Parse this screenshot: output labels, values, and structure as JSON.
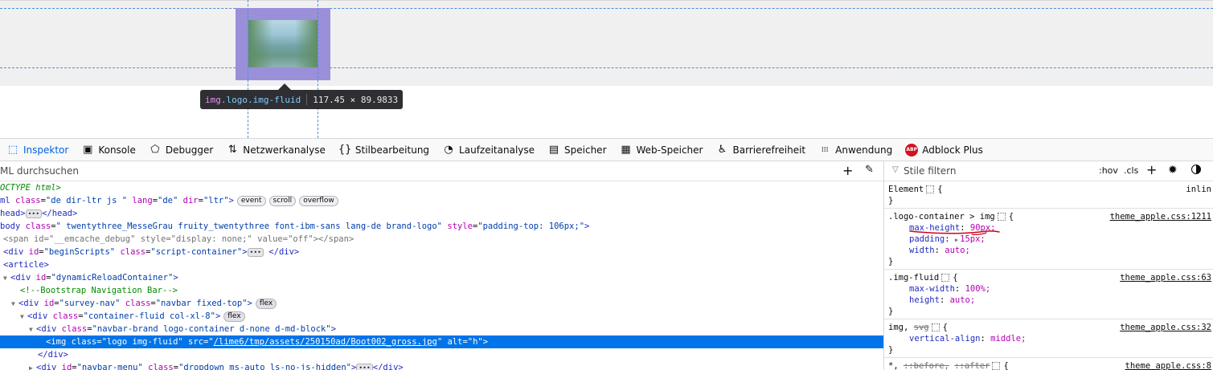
{
  "tooltip": {
    "tag": "img",
    "classes": ".logo.img-fluid",
    "dimensions": "117.45 × 89.9833"
  },
  "tabs": [
    {
      "label": "Inspektor",
      "icon": "inspector-icon",
      "glyph": "⬚"
    },
    {
      "label": "Konsole",
      "icon": "console-icon",
      "glyph": "▣"
    },
    {
      "label": "Debugger",
      "icon": "debugger-icon",
      "glyph": "⬠"
    },
    {
      "label": "Netzwerkanalyse",
      "icon": "network-icon",
      "glyph": "⇅"
    },
    {
      "label": "Stilbearbeitung",
      "icon": "style-editor-icon",
      "glyph": "{}"
    },
    {
      "label": "Laufzeitanalyse",
      "icon": "performance-icon",
      "glyph": "◔"
    },
    {
      "label": "Speicher",
      "icon": "memory-icon",
      "glyph": "▤"
    },
    {
      "label": "Web-Speicher",
      "icon": "storage-icon",
      "glyph": "▦"
    },
    {
      "label": "Barrierefreiheit",
      "icon": "accessibility-icon",
      "glyph": "♿"
    },
    {
      "label": "Anwendung",
      "icon": "application-icon",
      "glyph": "⁞⁞⁞"
    },
    {
      "label": "Adblock Plus",
      "icon": "adblock-plus-icon",
      "glyph": "ABP"
    }
  ],
  "markup": {
    "search_label": "ML durchsuchen",
    "lines": {
      "doctype": "OCTYPE html>",
      "html_tag": "ml",
      "html_class_attr": "class",
      "html_class_val": "\"de dir-ltr js \"",
      "html_lang_attr": "lang",
      "html_lang_val": "\"de\"",
      "html_dir_attr": "dir",
      "html_dir_val": "\"ltr\"",
      "badge_event": "event",
      "badge_scroll": "scroll",
      "badge_overflow": "overflow",
      "head_open": "head>",
      "head_close": "</head>",
      "body_tag": "body",
      "body_class_attr": "class",
      "body_class_val": "\"  twentythree_MesseGrau fruity_twentythree font-ibm-sans lang-de brand-logo\"",
      "body_style_attr": "style",
      "body_style_val": "\"padding-top: 106px;\"",
      "span_tag": "<span",
      "span_id_attr": "id",
      "span_id_val": "\"__emcache_debug\"",
      "span_style_attr": "style",
      "span_style_val": "\"display: none;\"",
      "span_value_attr": "value",
      "span_value_val": "\"off\"",
      "span_close": "></span>",
      "div_begin_tag": "<div",
      "div_begin_id_attr": "id",
      "div_begin_id_val": "\"beginScripts\"",
      "div_begin_class_attr": "class",
      "div_begin_class_val": "\"script-container\"",
      "div_close_tag": "</div>",
      "article": "<article>",
      "div_dyn_tag": "<div",
      "div_dyn_id_attr": "id",
      "div_dyn_id_val": "\"dynamicReloadContainer\"",
      "comment": "<!--Bootstrap Navigation Bar-->",
      "div_survey_tag": "<div",
      "div_survey_id_attr": "id",
      "div_survey_id_val": "\"survey-nav\"",
      "div_survey_class_attr": "class",
      "div_survey_class_val": "\"navbar fixed-top\"",
      "badge_flex": "flex",
      "div_container_tag": "<div",
      "div_container_class_attr": "class",
      "div_container_class_val": "\"container-fluid col-xl-8\"",
      "div_brand_tag": "<div",
      "div_brand_class_attr": "class",
      "div_brand_class_val": "\"navbar-brand logo-container d-none d-md-block\"",
      "img_tag": "<img",
      "img_class_attr": "class",
      "img_class_val": "\"logo img-fluid\"",
      "img_src_attr": "src",
      "img_src_val": "/lime6/tmp/assets/250150ad/Boot002_gross.jpg",
      "img_alt_attr": "alt",
      "img_alt_val": "\"h\"",
      "div_end": "</div>",
      "div_menu_tag": "<div",
      "div_menu_id_attr": "id",
      "div_menu_id_val": "\"navbar-menu\"",
      "div_menu_class_attr": "class",
      "div_menu_class_val": "\"dropdown ms-auto ls-no-js-hidden\"",
      "ellipsis": "•••"
    }
  },
  "rules": {
    "filter_label": "Stile filtern",
    "hov_label": ":hov",
    "cls_label": ".cls",
    "element": {
      "selector": "Element",
      "brace_open": "{",
      "brace_close": "}",
      "source": "inlin"
    },
    "logo_container": {
      "selector": ".logo-container > img",
      "source": "theme_apple.css:1211",
      "decls": [
        {
          "name": "max-height",
          "value": "90px;"
        },
        {
          "name": "padding",
          "value": "15px;"
        },
        {
          "name": "width",
          "value": "auto;"
        }
      ]
    },
    "img_fluid": {
      "selector": ".img-fluid",
      "source": "theme_apple.css:63",
      "decls": [
        {
          "name": "max-width",
          "value": "100%;"
        },
        {
          "name": "height",
          "value": "auto;"
        }
      ]
    },
    "img_svg": {
      "selector_img": "img,",
      "selector_svg": "svg",
      "source": "theme_apple.css:32",
      "decls": [
        {
          "name": "vertical-align",
          "value": "middle;"
        }
      ]
    },
    "universal": {
      "selector_star": "*,",
      "selector_before": "::before,",
      "selector_after": "::after",
      "source": "theme_apple.css:8"
    }
  },
  "colors": {
    "highlight": "#9a8fd9",
    "selected_row": "#0074e8",
    "annotation": "#d0021b"
  }
}
